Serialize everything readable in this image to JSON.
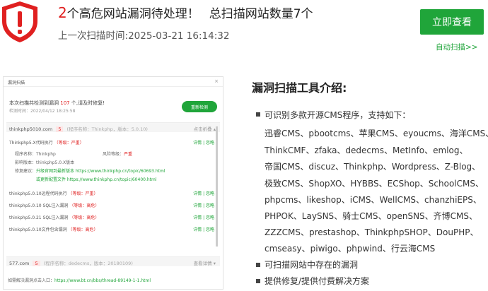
{
  "header": {
    "count": "2",
    "title_rest": "个高危网站漏洞待处理！",
    "total": "总扫描网站数量7个",
    "last_scan_label": "上一次扫描时间:",
    "last_scan_time": "2025-03-21 16:14:32",
    "view_button": "立即查看",
    "auto_scan": "自动扫描>>"
  },
  "colors": {
    "accent": "#20a53a",
    "danger": "#e02020"
  },
  "preview": {
    "head_title": "漏洞扫描",
    "close": "×",
    "info_prefix": "本次扫描共检测到漏洞",
    "info_count": "107",
    "info_suffix": "个,请及时修复!",
    "date": "检测时间：2022/04/12 18:25:58",
    "rescan": "重新检测",
    "site1": {
      "name": "thinkphp5010.com",
      "count": "5",
      "meta": "(程序名称：Thinkphp，版本：5.0.10)",
      "toggle": "点击折叠 ▴"
    },
    "rows": [
      {
        "name": "Thinkphp5.X代码执行",
        "level": "（等级：严重）",
        "actions": "详情 | 忽略"
      },
      {
        "name": "thinkphp5.0.10远程代码执行",
        "level": "（等级：严重）",
        "actions": "详情 | 忽略"
      },
      {
        "name": "thinkphp5.0.10 SQL注入漏洞",
        "level": "（等级：高危）",
        "actions": "详情 | 忽略"
      },
      {
        "name": "thinkphp5.0.21 SQL注入漏洞",
        "level": "（等级：高危）",
        "actions": "详情 | 忽略"
      },
      {
        "name": "thinkphp5.0.10文件包含漏洞",
        "level": "（等级：高危）",
        "actions": "详情 | 忽略"
      }
    ],
    "detail": {
      "program_label": "程序名称：",
      "program": "Thinkphp",
      "risk_label": "风险等级：",
      "risk": "严重",
      "version_label": "影响版本：",
      "version": "thinkphp5.0.X版本",
      "fix_label": "修复建议：",
      "fix": "升级官网到最新版本 https://www.thinkphp.cn/topic/60693.html",
      "fix2": "或更新配置文件 https://www.thinkphp.cn/topic/60400.html"
    },
    "site2": {
      "name": "577.com",
      "count": "5",
      "meta": "(程序名称：dedecms，版本：20180109)",
      "toggle": "查看详情 ▾"
    },
    "footer_prefix": "如需解决漏洞点击入口：",
    "footer_link": "https://www.bt.cn/bbs/thread-89149-1-1.html"
  },
  "intro": {
    "title": "漏洞扫描工具介绍:",
    "bullets": [
      "可识别多款开源CMS程序，支持如下：",
      "可扫描网站中存在的漏洞",
      "提供修复/提供付费解决方案"
    ],
    "cms_lines": [
      "迅睿CMS、pbootcms、苹果CMS、eyoucms、海洋CMS、",
      "ThinkCMF、zfaka、dedecms、MetInfo、emlog、",
      "帝国CMS、discuz、Thinkphp、Wordpress、Z-Blog、",
      "极致CMS、ShopXO、HYBBS、ECShop、SchoolCMS、",
      "phpcms、likeshop、iCMS、WellCMS、chanzhiEPS、",
      "PHPOK、LaySNS、骑士CMS、openSNS、齐博CMS、",
      "ZZZCMS、prestashop、ThinkphpSHOP、DouPHP、",
      "cmseasy、piwigo、phpwind、行云海CMS"
    ]
  }
}
